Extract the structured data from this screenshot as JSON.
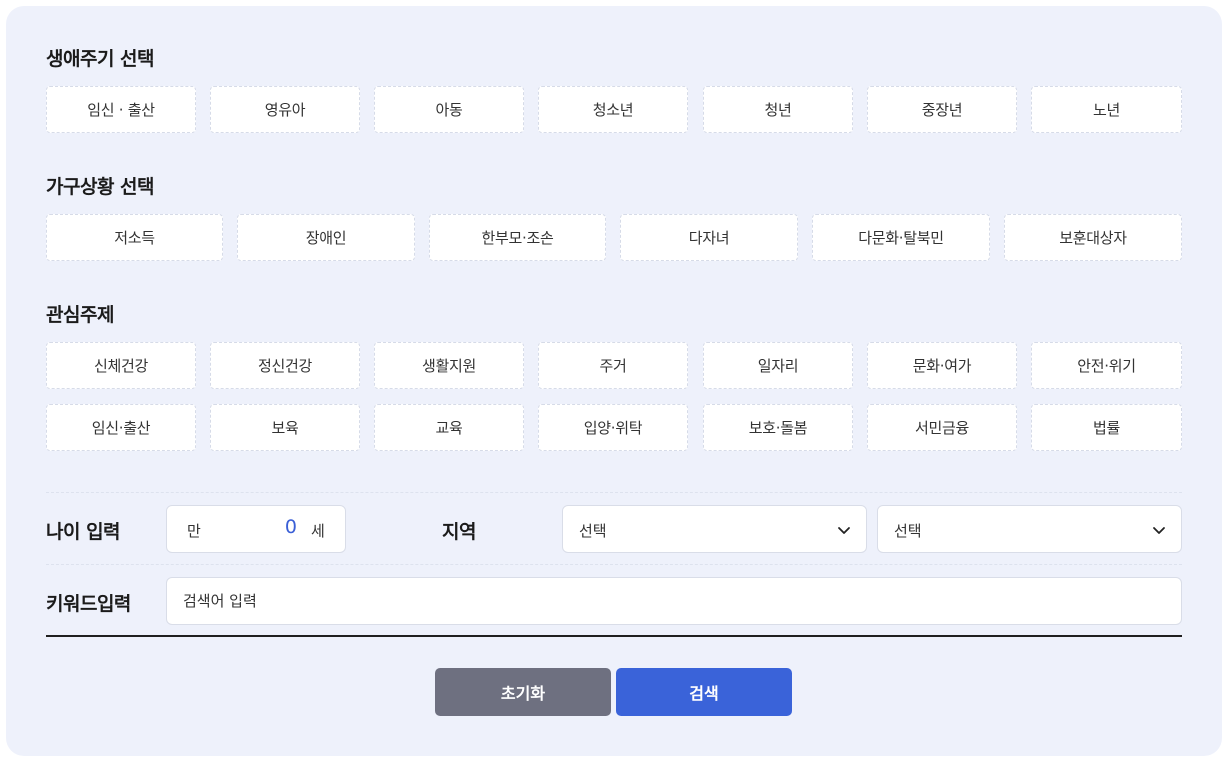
{
  "sections": {
    "life_cycle": {
      "title": "생애주기 선택",
      "items": [
        "임신 · 출산",
        "영유아",
        "아동",
        "청소년",
        "청년",
        "중장년",
        "노년"
      ]
    },
    "household": {
      "title": "가구상황 선택",
      "items": [
        "저소득",
        "장애인",
        "한부모·조손",
        "다자녀",
        "다문화·탈북민",
        "보훈대상자"
      ]
    },
    "interest": {
      "title": "관심주제",
      "row1": [
        "신체건강",
        "정신건강",
        "생활지원",
        "주거",
        "일자리",
        "문화·여가",
        "안전·위기"
      ],
      "row2": [
        "임신·출산",
        "보육",
        "교육",
        "입양·위탁",
        "보호·돌봄",
        "서민금융",
        "법률"
      ]
    }
  },
  "age": {
    "label": "나이 입력",
    "prefix": "만",
    "value": "0",
    "suffix": "세"
  },
  "region": {
    "label": "지역",
    "select1": "선택",
    "select2": "선택"
  },
  "keyword": {
    "label": "키워드입력",
    "placeholder": "검색어 입력"
  },
  "buttons": {
    "reset": "초기화",
    "search": "검색"
  },
  "colors": {
    "panel_bg": "#eef1fb",
    "search_button": "#3a63d9",
    "reset_button": "#6e7080",
    "age_value": "#3a5fd6"
  }
}
